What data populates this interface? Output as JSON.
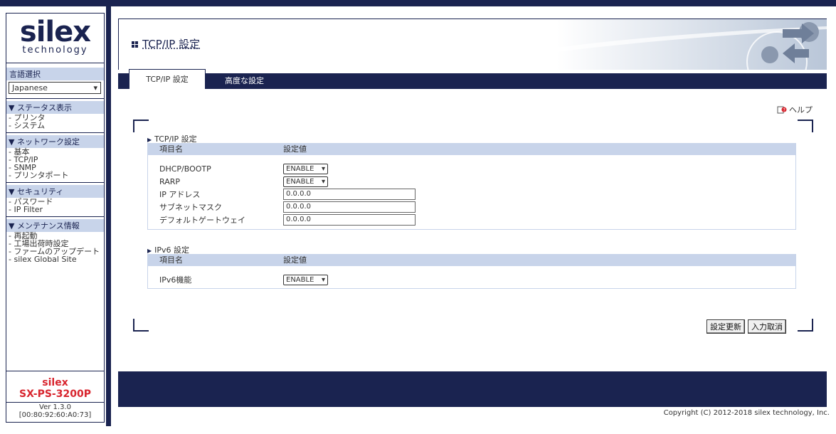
{
  "sidebar": {
    "logo_text": "silex",
    "logo_sub": "technology",
    "lang_label": "言語選択",
    "lang_value": "Japanese",
    "groups": [
      {
        "head": "▼ ステータス表示",
        "items": [
          "- プリンタ",
          "- システム"
        ]
      },
      {
        "head": "▼ ネットワーク設定",
        "items": [
          "- 基本",
          "- TCP/IP",
          "- SNMP",
          "- プリンタポート"
        ]
      },
      {
        "head": "▼ セキュリティ",
        "items": [
          "- パスワード",
          "- IP Filter"
        ]
      },
      {
        "head": "▼ メンテナンス情報",
        "items": [
          "- 再起動",
          "- 工場出荷時設定",
          "- ファームのアップデート",
          "- silex Global Site"
        ]
      }
    ],
    "model_brand": "silex",
    "model_name": "SX-PS-3200P",
    "version": "Ver 1.3.0",
    "mac": "[00:80:92:60:A0:73]"
  },
  "header": {
    "title": "TCP/IP 設定"
  },
  "tabs": {
    "active": "TCP/IP 設定",
    "second": "高度な設定"
  },
  "help_label": "ヘルプ",
  "tcpip": {
    "section_title": "TCP/IP 設定",
    "col_name": "項目名",
    "col_value": "設定値",
    "dhcp_label": "DHCP/BOOTP",
    "dhcp_value": "ENABLE",
    "rarp_label": "RARP",
    "rarp_value": "ENABLE",
    "ip_label": "IP アドレス",
    "ip_value": "0.0.0.0",
    "subnet_label": "サブネットマスク",
    "subnet_value": "0.0.0.0",
    "gateway_label": "デフォルトゲートウェイ",
    "gateway_value": "0.0.0.0"
  },
  "ipv6": {
    "section_title": "IPv6 設定",
    "col_name": "項目名",
    "col_value": "設定値",
    "func_label": "IPv6機能",
    "func_value": "ENABLE"
  },
  "buttons": {
    "submit": "設定更新",
    "reset": "入力取消"
  },
  "copyright": "Copyright (C) 2012-2018 silex technology, Inc.",
  "colors": {
    "navy": "#1a2350",
    "light_blue": "#c8d4ea",
    "brand_red": "#d8252e"
  }
}
